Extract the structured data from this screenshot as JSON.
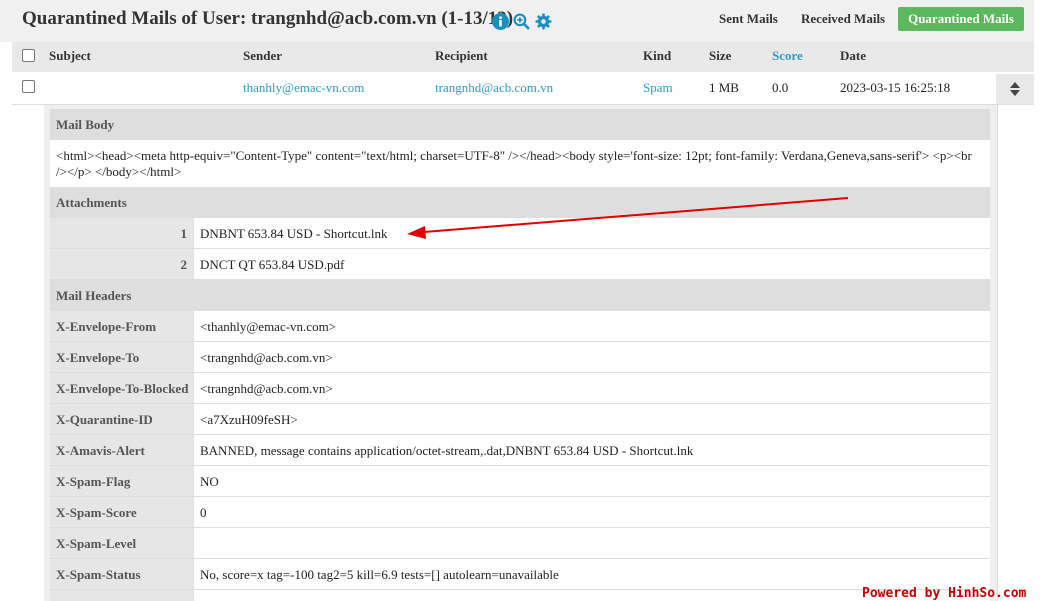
{
  "header": {
    "title": "Quarantined Mails of User: trangnhd@acb.com.vn (1-13/13)",
    "icons": [
      "info-icon",
      "zoom-in-icon",
      "gear-icon"
    ],
    "nav": {
      "sent": "Sent Mails",
      "received": "Received Mails",
      "quarantined": "Quarantined Mails"
    }
  },
  "table": {
    "columns": {
      "subject": "Subject",
      "sender": "Sender",
      "recipient": "Recipient",
      "kind": "Kind",
      "size": "Size",
      "score": "Score",
      "date": "Date"
    },
    "row": {
      "subject": "",
      "sender": "thanhly@emac-vn.com",
      "recipient": "trangnhd@acb.com.vn",
      "kind": "Spam",
      "size": "1 MB",
      "score": "0.0",
      "date": "2023-03-15 16:25:18"
    }
  },
  "detail": {
    "mail_body_label": "Mail Body",
    "mail_body": "<html><head><meta http-equiv=\"Content-Type\" content=\"text/html; charset=UTF-8\" /></head><body style='font-size: 12pt; font-family: Verdana,Geneva,sans-serif'> <p><br /></p> </body></html>",
    "attachments_label": "Attachments",
    "attachments": [
      {
        "index": "1",
        "name": "DNBNT 653.84 USD - Shortcut.lnk"
      },
      {
        "index": "2",
        "name": "DNCT QT 653.84 USD.pdf"
      }
    ],
    "headers_label": "Mail Headers",
    "headers": [
      {
        "key": "X-Envelope-From",
        "value": "<thanhly@emac-vn.com>"
      },
      {
        "key": "X-Envelope-To",
        "value": "<trangnhd@acb.com.vn>"
      },
      {
        "key": "X-Envelope-To-Blocked",
        "value": "<trangnhd@acb.com.vn>"
      },
      {
        "key": "X-Quarantine-ID",
        "value": "<a7XzuH09feSH>"
      },
      {
        "key": "X-Amavis-Alert",
        "value": "BANNED, message contains application/octet-stream,.dat,DNBNT 653.84 USD - Shortcut.lnk"
      },
      {
        "key": "X-Spam-Flag",
        "value": "NO"
      },
      {
        "key": "X-Spam-Score",
        "value": "0"
      },
      {
        "key": "X-Spam-Level",
        "value": ""
      },
      {
        "key": "X-Spam-Status",
        "value": "No, score=x tag=-100 tag2=5 kill=6.9 tests=[] autolearn=unavailable"
      }
    ]
  },
  "watermark": "Powered by HinhSo.com",
  "colors": {
    "accent_green": "#5cb85c",
    "link_blue": "#2a9fc4",
    "arrow_red": "#e00000"
  }
}
